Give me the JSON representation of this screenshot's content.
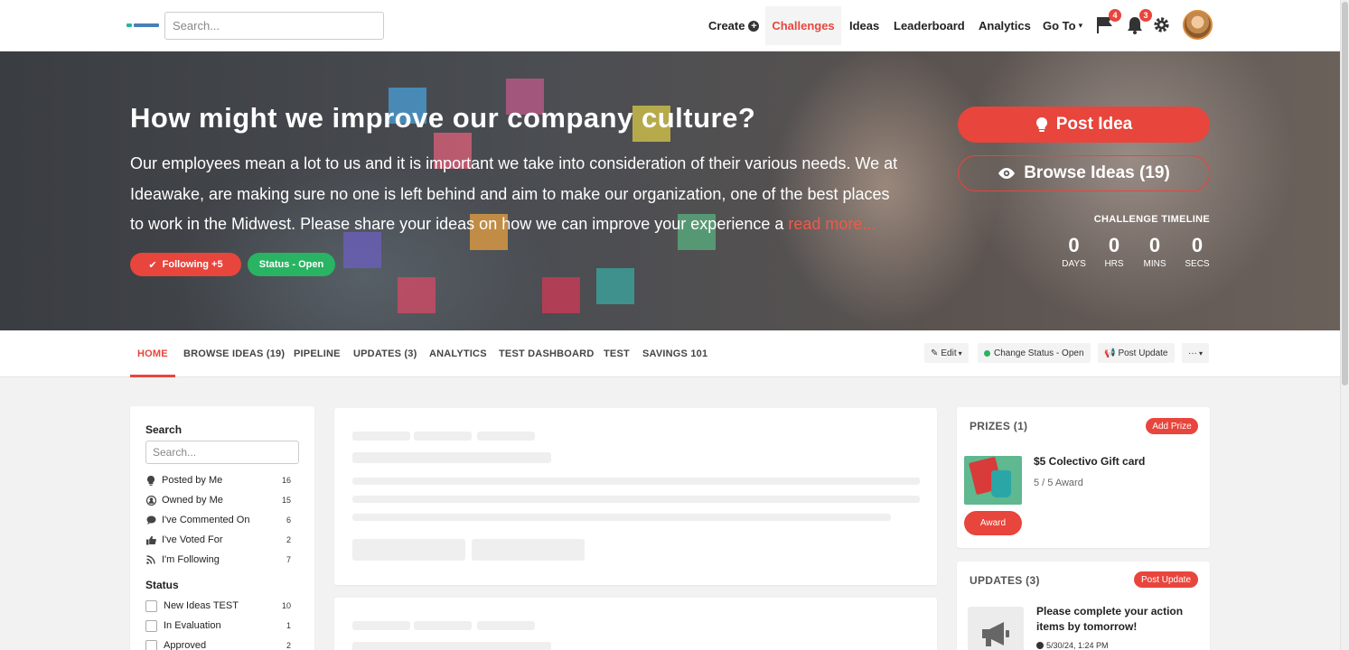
{
  "topbar": {
    "search_placeholder": "Search...",
    "nav": {
      "create": "Create",
      "challenges": "Challenges",
      "ideas": "Ideas",
      "leaderboard": "Leaderboard",
      "analytics": "Analytics",
      "goto": "Go To"
    },
    "flag_badge": "4",
    "bell_badge": "3"
  },
  "hero": {
    "title": "How might we improve our company culture?",
    "description": "Our employees mean a lot to us and it is important we take into consideration of their various needs. We at Ideawake, are making sure no one is left behind and aim to make our organization, one of the best places to work in the Midwest. Please share your ideas on how we can improve your experience a ",
    "read_more": "read more...",
    "following": "Following +5",
    "status": "Status - Open",
    "post_idea": "Post Idea",
    "browse_ideas": "Browse Ideas (19)",
    "timeline_title": "CHALLENGE TIMELINE",
    "timeline": [
      {
        "value": "0",
        "label": "DAYS"
      },
      {
        "value": "0",
        "label": "HRS"
      },
      {
        "value": "0",
        "label": "MINS"
      },
      {
        "value": "0",
        "label": "SECS"
      }
    ]
  },
  "tabs": [
    "HOME",
    "BROWSE IDEAS (19)",
    "PIPELINE",
    "UPDATES (3)",
    "ANALYTICS",
    "TEST DASHBOARD",
    "TEST",
    "SAVINGS 101"
  ],
  "tools": {
    "edit": "Edit",
    "change_status": "Change Status - Open",
    "post_update": "Post Update",
    "more": "···"
  },
  "sidebar": {
    "search_heading": "Search",
    "search_placeholder": "Search...",
    "filters": [
      {
        "label": "Posted by Me",
        "count": "16",
        "icon": "lightbulb-icon"
      },
      {
        "label": "Owned by Me",
        "count": "15",
        "icon": "users-icon"
      },
      {
        "label": "I've Commented On",
        "count": "6",
        "icon": "comment-icon"
      },
      {
        "label": "I've Voted For",
        "count": "2",
        "icon": "thumbs-up-icon"
      },
      {
        "label": "I'm Following",
        "count": "7",
        "icon": "rss-icon"
      }
    ],
    "status_heading": "Status",
    "statuses": [
      {
        "label": "New Ideas TEST",
        "count": "10"
      },
      {
        "label": "In Evaluation",
        "count": "1"
      },
      {
        "label": "Approved",
        "count": "2"
      }
    ]
  },
  "prizes": {
    "title": "PRIZES (1)",
    "add": "Add Prize",
    "name": "$5 Colectivo Gift card",
    "sub": "5 / 5 Award",
    "award": "Award"
  },
  "updates": {
    "title": "UPDATES (3)",
    "post": "Post Update",
    "item_title": "Please complete your action items by tomorrow!",
    "item_time": "5/30/24, 1:24 PM"
  },
  "colors": {
    "accent": "#e8453c",
    "green": "#28b463"
  }
}
